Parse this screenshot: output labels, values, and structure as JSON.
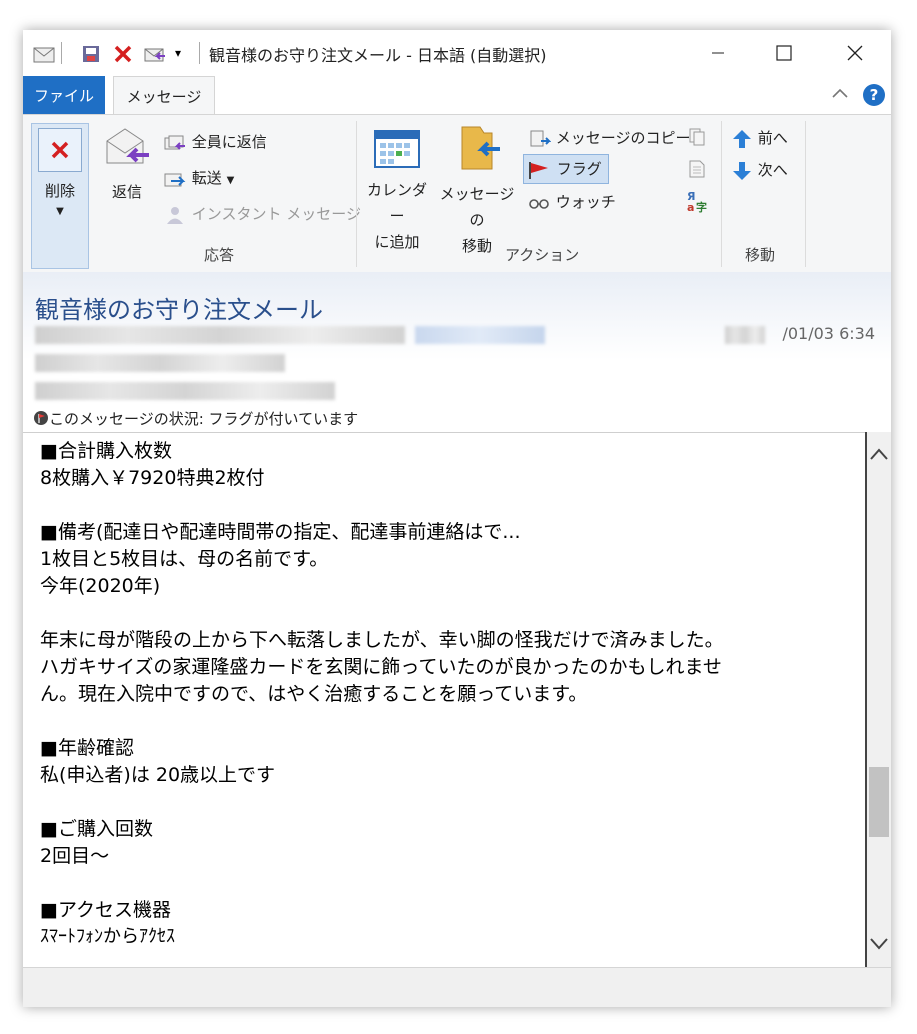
{
  "window": {
    "title": "観音様のお守り注文メール - 日本語 (自動選択)"
  },
  "ribbon_tabs": {
    "file": "ファイル",
    "message": "メッセージ"
  },
  "ribbon": {
    "delete": "削除",
    "reply": "返信",
    "reply_all": "全員に返信",
    "forward": "転送",
    "instant_message": "インスタント メッセージ",
    "group_respond": "応答",
    "add_calendar_1": "カレンダー",
    "add_calendar_2": "に追加",
    "move_msg_1": "メッセージの",
    "move_msg_2": "移動",
    "copy_msg": "メッセージのコピー",
    "flag": "フラグ",
    "watch": "ウォッチ",
    "group_action": "アクション",
    "prev": "前へ",
    "next": "次へ",
    "group_move": "移動"
  },
  "header": {
    "subject": "観音様のお守り注文メール",
    "date": "/01/03 6:34",
    "status": "このメッセージの状況: フラグが付いています"
  },
  "body": {
    "lines": [
      "■合計購入枚数",
      "8枚購入￥7920特典2枚付",
      "",
      "■備考(配達日や配達時間帯の指定、配達事前連絡はで...",
      "1枚目と5枚目は、母の名前です。",
      "今年(2020年)",
      "",
      "年末に母が階段の上から下へ転落しましたが、幸い脚の怪我だけで済みました。",
      "ハガキサイズの家運隆盛カードを玄関に飾っていたのが良かったのかもしれませ",
      "ん。現在入院中ですので、はやく治癒することを願っています。",
      "",
      "■年齢確認",
      "私(申込者)は 20歳以上です",
      "",
      "■ご購入回数",
      "2回目～",
      "",
      "■アクセス機器",
      "ｽﾏｰﾄﾌｫﾝからｱｸｾｽ"
    ]
  }
}
